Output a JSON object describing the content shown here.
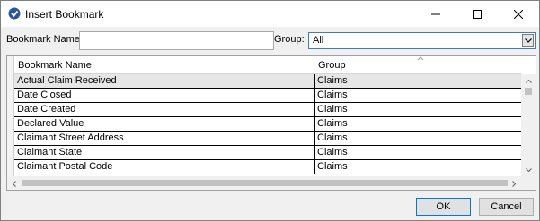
{
  "window": {
    "title": "Insert Bookmark",
    "icons": [
      "app-icon",
      "minimize-icon",
      "maximize-icon",
      "close-icon"
    ]
  },
  "form": {
    "bookmark_name_label": "Bookmark Name:",
    "bookmark_name_value": "",
    "group_label": "Group:",
    "group_selected": "All"
  },
  "grid": {
    "columns": [
      "Bookmark Name",
      "Group"
    ],
    "rows": [
      {
        "name": "Actual Claim Received",
        "group": "Claims"
      },
      {
        "name": "Date Closed",
        "group": "Claims"
      },
      {
        "name": "Date Created",
        "group": "Claims"
      },
      {
        "name": "Declared Value",
        "group": "Claims"
      },
      {
        "name": "Claimant Street Address",
        "group": "Claims"
      },
      {
        "name": "Claimant State",
        "group": "Claims"
      },
      {
        "name": "Claimant Postal Code",
        "group": "Claims"
      }
    ]
  },
  "buttons": {
    "ok": "OK",
    "cancel": "Cancel"
  },
  "colors": {
    "accent": "#0078d7",
    "selected_row": "#e6e6e6"
  }
}
